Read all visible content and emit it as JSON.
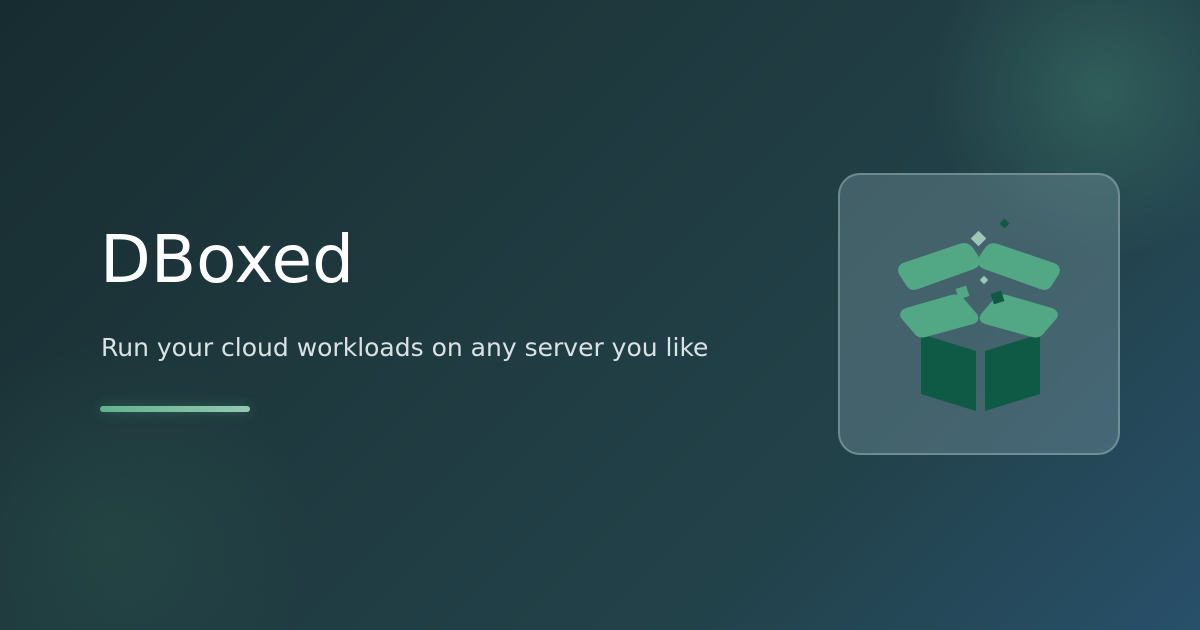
{
  "page": {
    "title": "DBoxed",
    "subtitle": "Run your cloud workloads on any server you like"
  },
  "logo": {
    "icon": "open-box-icon"
  },
  "colors": {
    "accent": "#63b28b",
    "box_lid": "#52a885",
    "box_body": "#0f5a45",
    "background": "#1f3a3f"
  }
}
